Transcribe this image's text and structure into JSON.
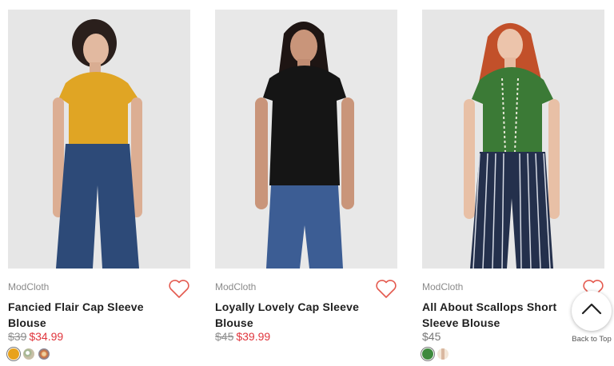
{
  "products": [
    {
      "brand": "ModCloth",
      "title": "Fancied Flair Cap Sleeve Blouse",
      "price_was": "$39",
      "price_now": "$34.99",
      "price_regular": "",
      "photo_alt": "model-in-mustard-blouse",
      "swatches": [
        "#e8a21c",
        "#b8b8a8",
        "#d0703a"
      ]
    },
    {
      "brand": "ModCloth",
      "title": "Loyally Lovely Cap Sleeve Blouse",
      "price_was": "$45",
      "price_now": "$39.99",
      "price_regular": "",
      "photo_alt": "model-in-black-blouse",
      "swatches": []
    },
    {
      "brand": "ModCloth",
      "title": "All About Scallops Short Sleeve Blouse",
      "price_was": "",
      "price_now": "",
      "price_regular": "$45",
      "photo_alt": "model-in-green-blouse",
      "swatches": [
        "#3f8a3e",
        "#e8d8c8"
      ]
    }
  ],
  "back_to_top": {
    "label": "Back to Top",
    "icon": "chevron-up-icon"
  },
  "colors": {
    "sale": "#e0363d",
    "heart": "#e45a4f",
    "muted": "#8a8a8a"
  }
}
